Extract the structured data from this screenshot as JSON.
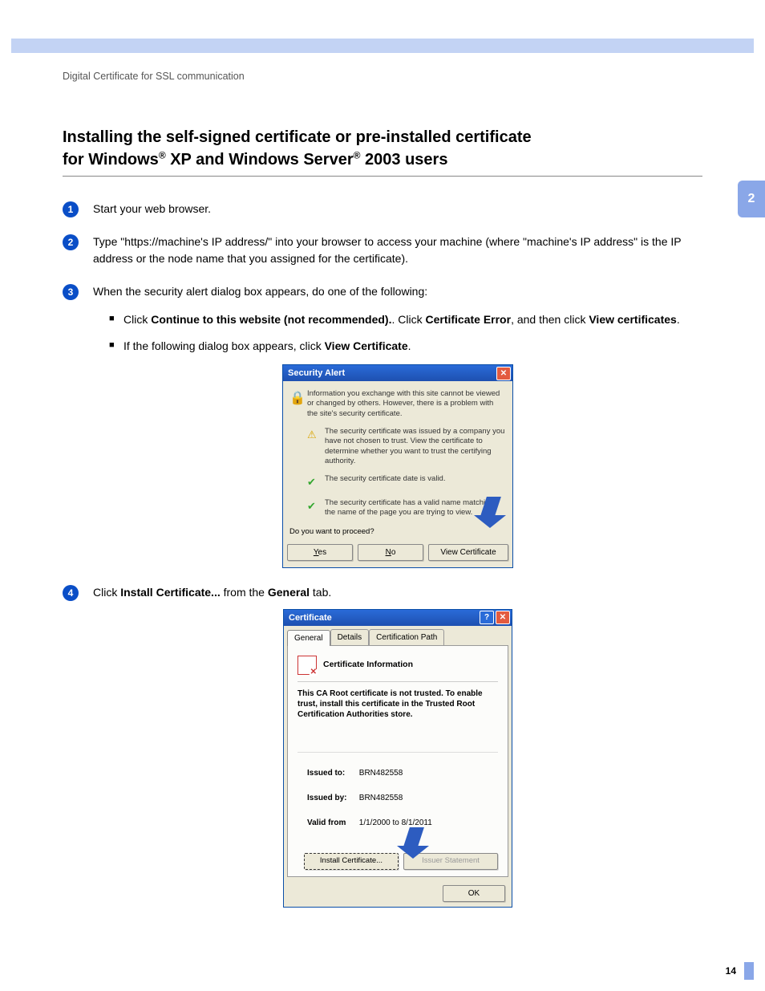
{
  "breadcrumb": "Digital Certificate for SSL communication",
  "heading": {
    "line1_pre": "Installing the self-signed certificate or pre-installed certificate ",
    "line2_a": "for Windows",
    "line2_b": " XP and Windows Server",
    "line2_c": " 2003 users",
    "reg": "®"
  },
  "chapter": "2",
  "page_number": "14",
  "steps": {
    "s1": "Start your web browser.",
    "s2": "Type \"https://machine's IP address/\" into your browser to access your machine (where \"machine's IP address\" is the IP address or the node name that you assigned for the certificate).",
    "s3": "When the security alert dialog box appears, do one of the following:",
    "s3_bullets": {
      "b1_pre": "Click ",
      "b1_bold1": "Continue to this website (not recommended).",
      "b1_mid": ". Click ",
      "b1_bold2": "Certificate Error",
      "b1_mid2": ", and then click ",
      "b1_bold3": "View certificates",
      "b1_end": ".",
      "b2_pre": "If the following dialog box appears, click ",
      "b2_bold": "View Certificate",
      "b2_end": "."
    },
    "s4_pre": "Click ",
    "s4_bold1": "Install Certificate...",
    "s4_mid": " from the ",
    "s4_bold2": "General",
    "s4_end": " tab."
  },
  "dlg1": {
    "title": "Security Alert",
    "body1": "Information you exchange with this site cannot be viewed or changed by others. However, there is a problem with the site's security certificate.",
    "warn": "The security certificate was issued by a company you have not chosen to trust. View the certificate to determine whether you want to trust the certifying authority.",
    "ok1": "The security certificate date is valid.",
    "ok2": "The security certificate has a valid name matching the name of the page you are trying to view.",
    "prompt": "Do you want to proceed?",
    "yes": "Yes",
    "no": "No",
    "view": "View Certificate"
  },
  "dlg2": {
    "title": "Certificate",
    "tabs": {
      "general": "General",
      "details": "Details",
      "path": "Certification Path"
    },
    "cert_info": "Certificate Information",
    "msg": "This CA Root certificate is not trusted. To enable trust, install this certificate in the Trusted Root Certification Authorities store.",
    "issued_to_lbl": "Issued to:",
    "issued_to": "BRN482558",
    "issued_by_lbl": "Issued by:",
    "issued_by": "BRN482558",
    "valid_lbl": "Valid from",
    "valid": "1/1/2000  to  8/1/2011",
    "install": "Install Certificate...",
    "issuer_stmt": "Issuer Statement",
    "ok": "OK"
  },
  "close_x": "✕",
  "help_q": "?"
}
